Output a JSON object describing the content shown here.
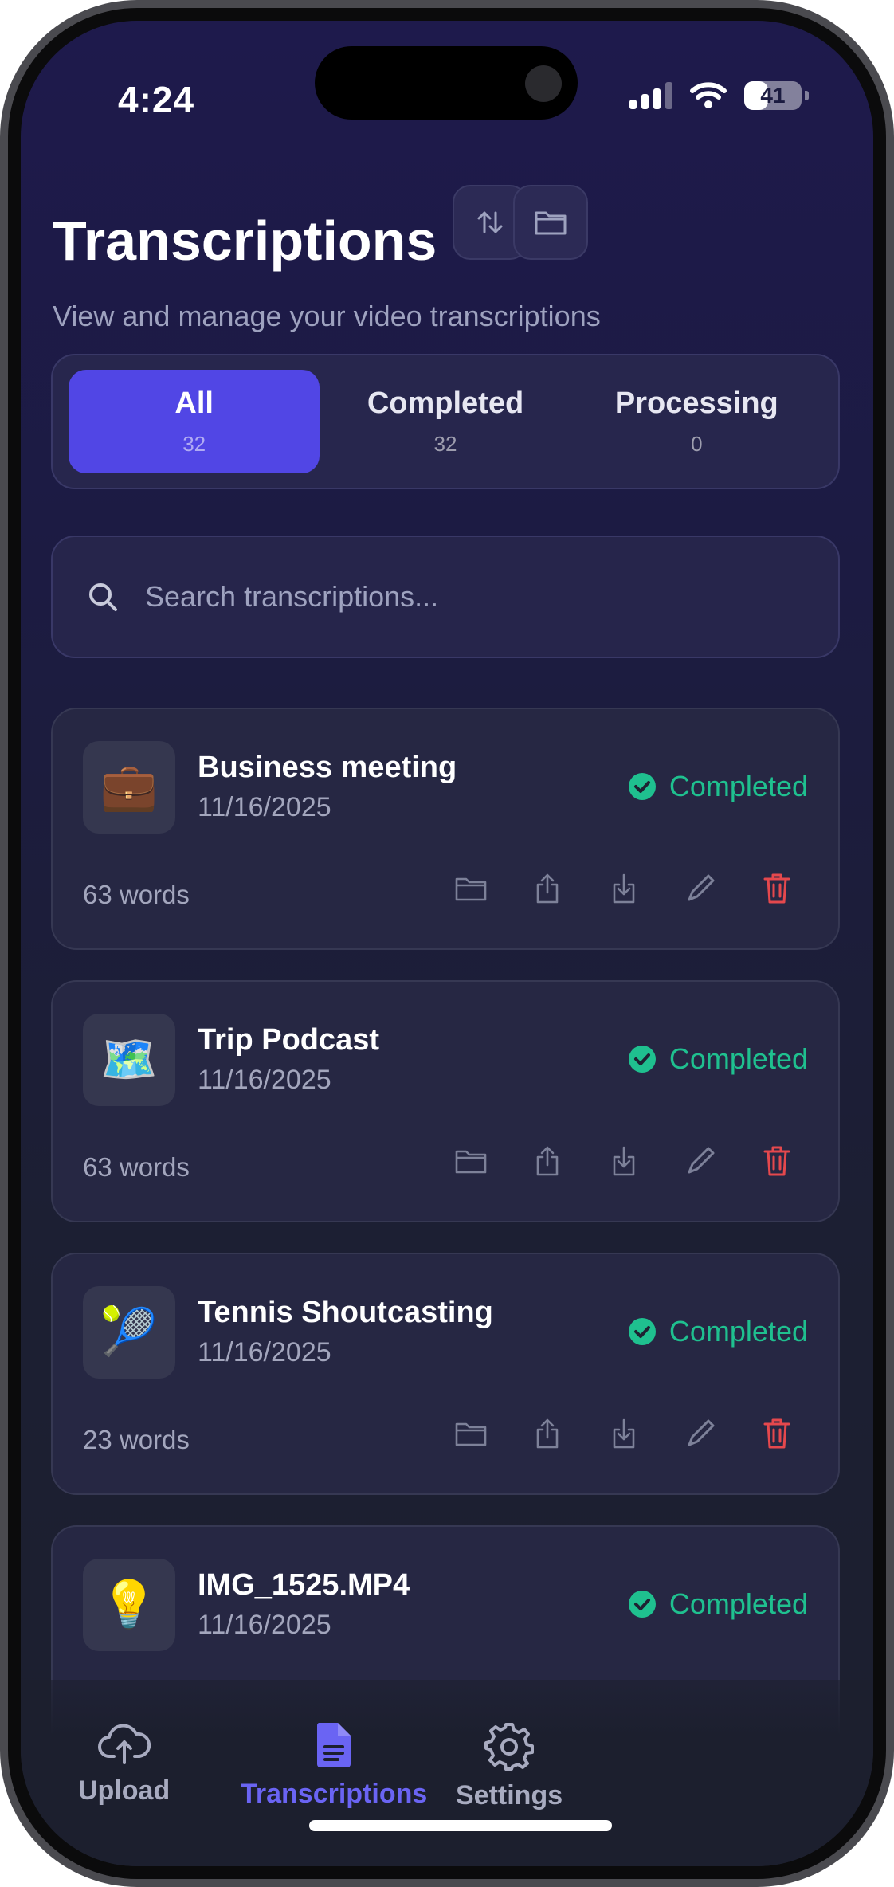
{
  "status_bar": {
    "time": "4:24",
    "battery": "41",
    "battery_level": 0.41
  },
  "header": {
    "title": "Transcriptions",
    "subtitle": "View and manage your video transcriptions",
    "sort_icon": "sort-arrows-icon",
    "folder_icon": "folder-icon"
  },
  "tabs": [
    {
      "label": "All",
      "count": "32",
      "active": true
    },
    {
      "label": "Completed",
      "count": "32",
      "active": false
    },
    {
      "label": "Processing",
      "count": "0",
      "active": false
    }
  ],
  "search": {
    "placeholder": "Search transcriptions..."
  },
  "cards": [
    {
      "emoji": "💼",
      "title": "Business meeting",
      "date": "11/16/2025",
      "status": "Completed",
      "words": "63 words"
    },
    {
      "emoji": "🗺️",
      "title": "Trip Podcast",
      "date": "11/16/2025",
      "status": "Completed",
      "words": "63 words"
    },
    {
      "emoji": "🎾",
      "title": "Tennis Shoutcasting",
      "date": "11/16/2025",
      "status": "Completed",
      "words": "23 words"
    },
    {
      "emoji": "💡",
      "title": "IMG_1525.MP4",
      "date": "11/16/2025",
      "status": "Completed",
      "words": ""
    }
  ],
  "nav": {
    "upload": "Upload",
    "transcriptions": "Transcriptions",
    "settings": "Settings"
  },
  "colors": {
    "accent": "#5146e5",
    "status_green": "#1fc08f",
    "delete_red": "#e5484d",
    "nav_active": "#6a64f3"
  }
}
